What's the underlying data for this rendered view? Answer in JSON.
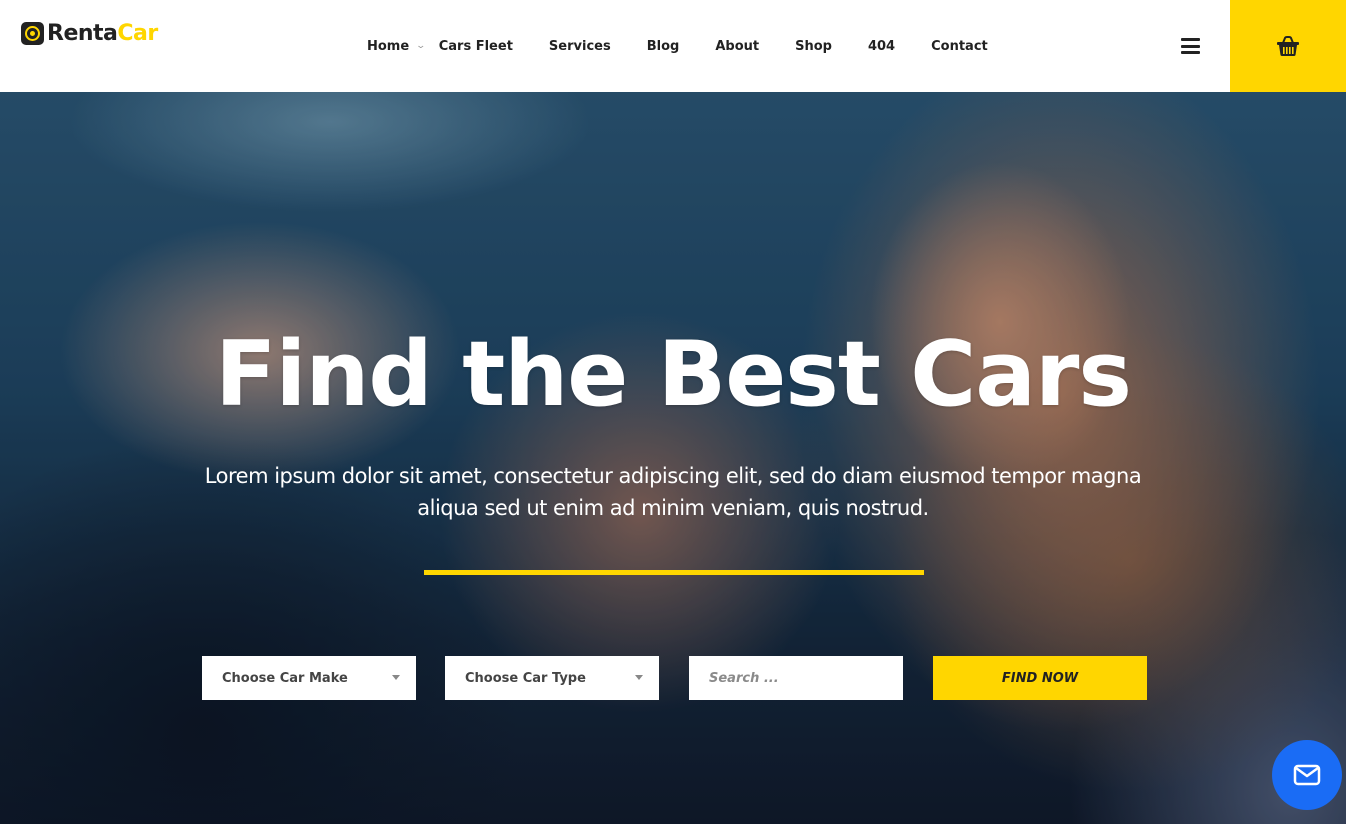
{
  "brand": {
    "logo_part1": "Renta",
    "logo_part2": "Car",
    "logo_icon": "tire-icon",
    "accent_color": "#ffd600",
    "dark_color": "#222222"
  },
  "nav": {
    "items": [
      {
        "label": "Home",
        "has_dropdown": true
      },
      {
        "label": "Cars Fleet"
      },
      {
        "label": "Services"
      },
      {
        "label": "Blog"
      },
      {
        "label": "About"
      },
      {
        "label": "Shop"
      },
      {
        "label": "404"
      },
      {
        "label": "Contact"
      }
    ],
    "dropdown_glyph": "⌄",
    "menu_icon": "hamburger-icon",
    "cart_icon": "basket-icon"
  },
  "hero": {
    "title": "Find the Best Cars",
    "subtitle": "Lorem ipsum dolor sit amet, consectetur adipiscing elit, sed do diam eiusmod tempor magna aliqua sed ut enim ad minim veniam, quis nostrud."
  },
  "search": {
    "car_make": {
      "selected": "Choose Car Make"
    },
    "car_type": {
      "selected": "Choose Car Type"
    },
    "query": {
      "value": "",
      "placeholder": "Search ..."
    },
    "submit_label": "FIND NOW"
  },
  "floating": {
    "contact_icon": "envelope-icon",
    "contact_color": "#1a6cf5"
  }
}
